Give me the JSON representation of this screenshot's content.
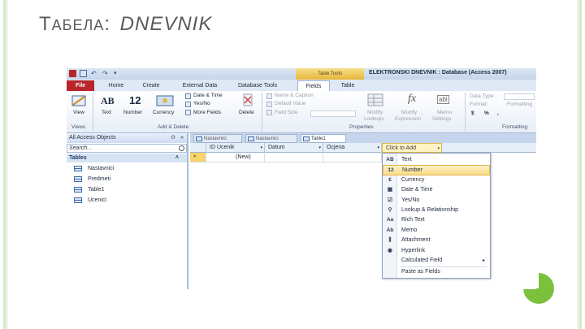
{
  "slide": {
    "title_first": "Т",
    "title_small": "АБЕЛА",
    "title_sep": ":",
    "title_rest": "DNEVNIK",
    "accent_green": "#7cc13c",
    "border_green": "#d7eccd"
  },
  "window": {
    "title": "ELEKTRONSKI DNEVNIK : Database (Access 2007)",
    "context_tab": "Table Tools"
  },
  "ribbon_tabs": [
    "File",
    "Home",
    "Create",
    "External Data",
    "Database Tools",
    "Fields",
    "Table"
  ],
  "ribbon": {
    "view_label": "View",
    "views_group": "Views",
    "text_label": "Text",
    "number_label": "Number",
    "currency_label": "Currency",
    "date_time": "Date & Time",
    "yes_no": "Yes/No",
    "more_fields": "More Fields",
    "delete_label": "Delete",
    "add_delete_group": "Add & Delete",
    "name_caption": "Name & Caption",
    "default_value": "Default Value",
    "field_size": "Field Size",
    "properties_group": "Properties",
    "modify_lookups": "Modify",
    "modify_lookups_sub": "Lookups",
    "modify_expression": "Modify",
    "modify_expression_sub": "Expression",
    "memo_settings": "Memo",
    "memo_settings_sub": "Settings",
    "data_type": "Data Type:",
    "format": "Format:",
    "formatting": "Formatting",
    "formatting_group": "Formatting",
    "ab_icon": "AB",
    "twelve_icon": "12",
    "fx_icon": "fx",
    "abl_icon": "abl",
    "dollar": "$",
    "percent": "%",
    "comma": ","
  },
  "nav": {
    "header": "All Access Objects",
    "search_placeholder": "Search...",
    "group": "Tables",
    "items": [
      "Nastavnici",
      "Predmeti",
      "Table1",
      "Ucenici"
    ]
  },
  "doc_tabs": [
    "Nastavnici",
    "Nastavnici",
    "Table1"
  ],
  "grid": {
    "columns": [
      "ID Ucenik",
      "Datum",
      "Ocjena"
    ],
    "click_to_add": "Click to Add",
    "new_row": "(New)",
    "new_star": "*"
  },
  "menu": {
    "items": [
      {
        "icon": "AB",
        "label": "Text"
      },
      {
        "icon": "12",
        "label": "Number"
      },
      {
        "icon": "€",
        "label": "Currency"
      },
      {
        "icon": "▦",
        "label": "Date & Time"
      },
      {
        "icon": "☑",
        "label": "Yes/No"
      },
      {
        "icon": "⚲",
        "label": "Lookup & Relationship"
      },
      {
        "icon": "Aa",
        "label": "Rich Text"
      },
      {
        "icon": "Ab",
        "label": "Memo"
      },
      {
        "icon": "⫼",
        "label": "Attachment"
      },
      {
        "icon": "◉",
        "label": "Hyperlink"
      },
      {
        "icon": "",
        "label": "Calculated Field"
      },
      {
        "icon": "",
        "label": "Paste as Fields"
      }
    ],
    "highlighted": "Number"
  }
}
